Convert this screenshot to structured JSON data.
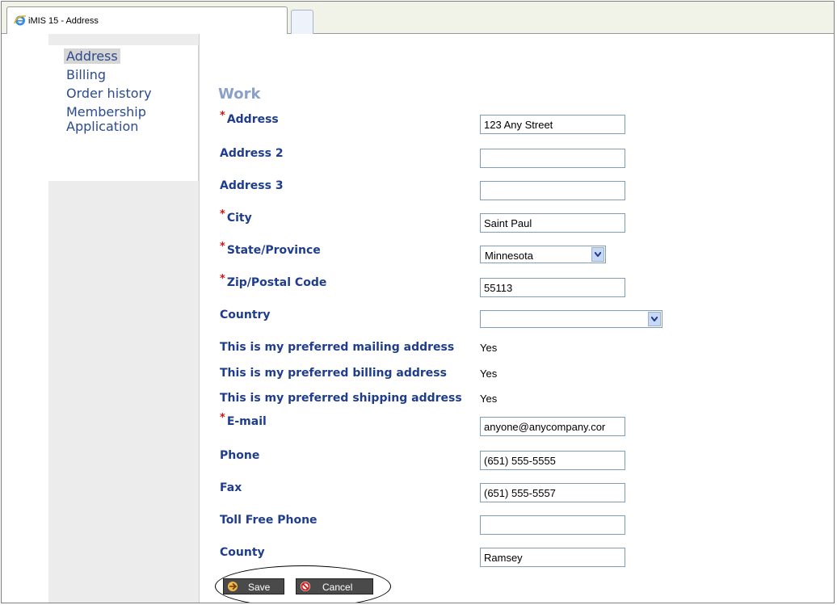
{
  "window": {
    "tab_title": "iMIS 15 - Address"
  },
  "sidebar": {
    "items": [
      {
        "label": "Address"
      },
      {
        "label": "Billing"
      },
      {
        "label": "Order history"
      },
      {
        "label": "Membership"
      },
      {
        "label": "Application"
      }
    ]
  },
  "form": {
    "section_title": "Work",
    "address": {
      "label": "Address",
      "value": "123 Any Street"
    },
    "address2": {
      "label": "Address 2",
      "value": ""
    },
    "address3": {
      "label": "Address 3",
      "value": ""
    },
    "city": {
      "label": "City",
      "value": "Saint Paul"
    },
    "state": {
      "label": "State/Province",
      "value": "Minnesota"
    },
    "zip": {
      "label": "Zip/Postal Code",
      "value": "55113"
    },
    "country": {
      "label": "Country",
      "value": ""
    },
    "pref_mailing": {
      "label": "This is my preferred mailing address",
      "value": "Yes"
    },
    "pref_billing": {
      "label": "This is my preferred billing address",
      "value": "Yes"
    },
    "pref_shipping": {
      "label": "This is my preferred shipping address",
      "value": "Yes"
    },
    "email": {
      "label": "E-mail",
      "value": "anyone@anycompany.cor"
    },
    "phone": {
      "label": "Phone",
      "value": "(651) 555-5555"
    },
    "fax": {
      "label": "Fax",
      "value": "(651) 555-5557"
    },
    "tollfree": {
      "label": "Toll Free Phone",
      "value": ""
    },
    "county": {
      "label": "County",
      "value": "Ramsey"
    },
    "required_marker": "*"
  },
  "buttons": {
    "save": "Save",
    "cancel": "Cancel"
  },
  "colors": {
    "label": "#1f3d8c",
    "required": "#d21414",
    "section": "#8aa0c8"
  }
}
